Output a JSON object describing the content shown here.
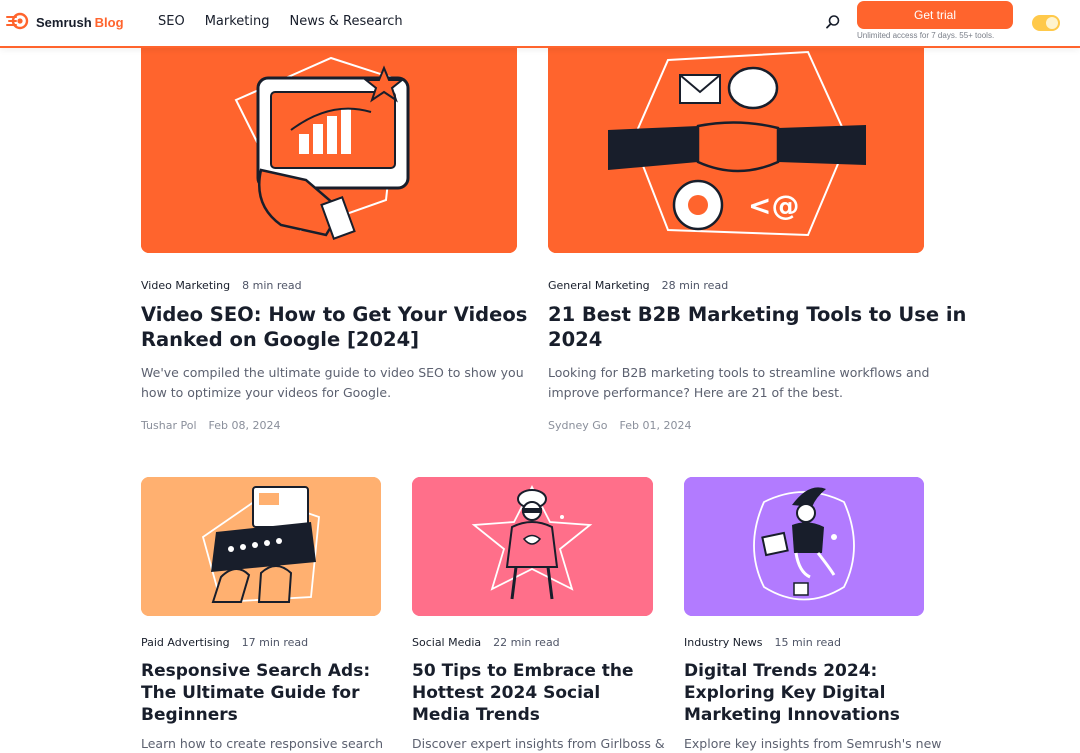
{
  "header": {
    "brand": "Semrush",
    "brand_suffix": "Blog",
    "nav": [
      "SEO",
      "Marketing",
      "News & Research"
    ],
    "trial_label": "Get trial",
    "trial_note": "Unlimited access for 7 days. 55+ tools."
  },
  "colors": {
    "accent": "#ff642d",
    "text": "#181e2b",
    "peach": "#ffb070",
    "pink": "#ff6f8a",
    "purple": "#b27bff"
  },
  "articles": [
    {
      "category": "Video Marketing",
      "read": "8 min read",
      "title_lines": [
        "Video SEO: How to Get Your Videos",
        "Ranked on Google [2024]"
      ],
      "desc_lines": [
        "We've compiled the ultimate guide to video SEO to show you",
        "how to optimize your videos for Google."
      ],
      "author": "Tushar Pol",
      "date": "Feb 08, 2024"
    },
    {
      "category": "General Marketing",
      "read": "28 min read",
      "title_lines": [
        "21 Best B2B Marketing Tools to Use in",
        "2024"
      ],
      "desc_lines": [
        "Looking for B2B marketing tools to streamline workflows and",
        "improve performance? Here are 21 of the best."
      ],
      "author": "Sydney Go",
      "date": "Feb 01, 2024"
    },
    {
      "category": "Paid Advertising",
      "read": "17 min read",
      "title_lines": [
        "Responsive Search Ads:",
        "The Ultimate Guide for",
        "Beginners"
      ],
      "desc_lines": [
        "Learn how to create responsive search"
      ]
    },
    {
      "category": "Social Media",
      "read": "22 min read",
      "title_lines": [
        "50 Tips to Embrace the",
        "Hottest 2024 Social",
        "Media Trends"
      ],
      "desc_lines": [
        "Discover expert insights from Girlboss &"
      ]
    },
    {
      "category": "Industry News",
      "read": "15 min read",
      "title_lines": [
        "Digital Trends 2024:",
        "Exploring Key Digital",
        "Marketing Innovations"
      ],
      "desc_lines": [
        "Explore key insights from Semrush's new"
      ]
    }
  ]
}
